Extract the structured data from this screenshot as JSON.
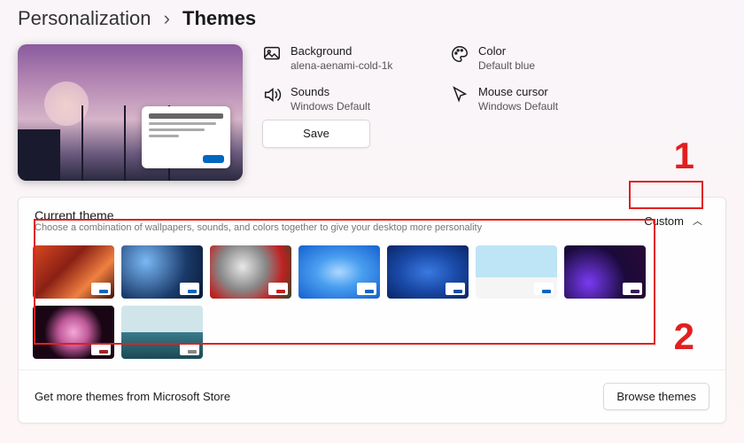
{
  "breadcrumb": {
    "parent": "Personalization",
    "current": "Themes"
  },
  "settings": {
    "background": {
      "label": "Background",
      "value": "alena-aenami-cold-1k"
    },
    "color": {
      "label": "Color",
      "value": "Default blue"
    },
    "sounds": {
      "label": "Sounds",
      "value": "Windows Default"
    },
    "cursor": {
      "label": "Mouse cursor",
      "value": "Windows Default"
    },
    "save_label": "Save"
  },
  "current_theme": {
    "title": "Current theme",
    "subtitle": "Choose a combination of wallpapers, sounds, and colors together to give your desktop more personality",
    "expander_value": "Custom"
  },
  "footer": {
    "text": "Get more themes from Microsoft Store",
    "browse_label": "Browse themes"
  },
  "annotations": {
    "one": "1",
    "two": "2"
  }
}
